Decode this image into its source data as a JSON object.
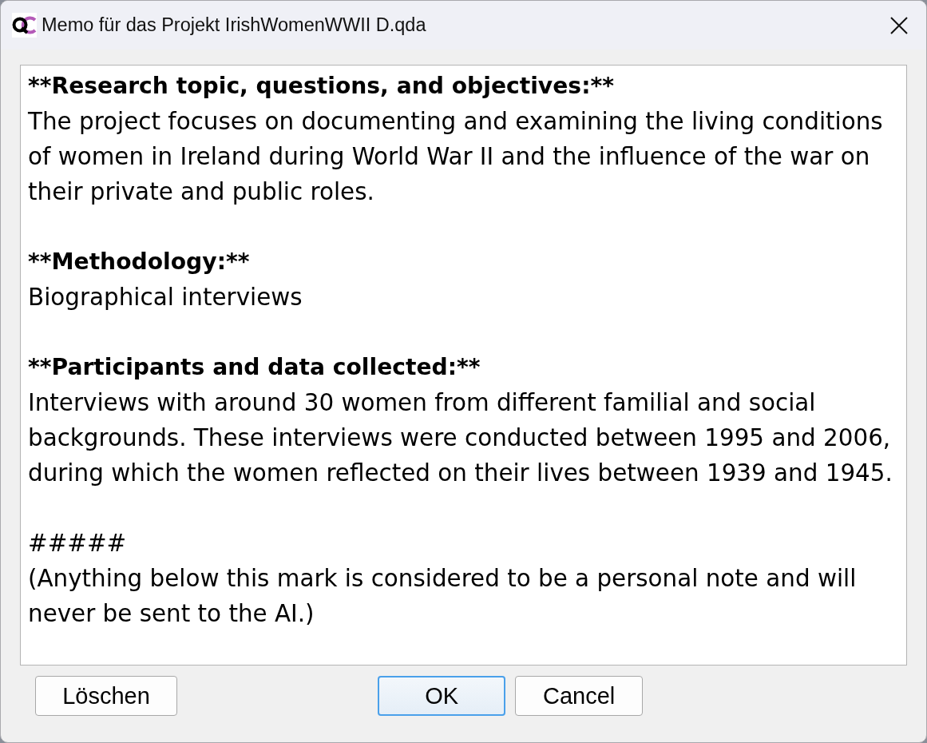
{
  "window": {
    "title": "Memo für das Projekt IrishWomenWWII D.qda"
  },
  "memo": {
    "blocks": [
      {
        "lines": [
          {
            "kind": "heading",
            "text": "**Research topic, questions, and objectives:**"
          },
          {
            "kind": "text",
            "text": "The project focuses on documenting and examining the living conditions of women in Ireland during World War II and the influence of the war on their private and public roles."
          }
        ]
      },
      {
        "lines": [
          {
            "kind": "heading",
            "text": "**Methodology:**"
          },
          {
            "kind": "text",
            "text": "Biographical interviews"
          }
        ]
      },
      {
        "lines": [
          {
            "kind": "heading",
            "text": "**Participants and data collected:**"
          },
          {
            "kind": "text",
            "text": "Interviews with around 30 women from different familial and social backgrounds. These interviews were conducted between 1995 and 2006, during which the women reflected on their lives between 1939 and 1945."
          }
        ]
      },
      {
        "lines": [
          {
            "kind": "text",
            "text": "#####"
          },
          {
            "kind": "text",
            "text": "(Anything below this mark is considered to be a personal note and will never be sent to the AI.)"
          }
        ]
      }
    ]
  },
  "buttons": {
    "left": [
      {
        "label": "Löschen",
        "default": false
      }
    ],
    "right": [
      {
        "label": "OK",
        "default": true
      },
      {
        "label": "Cancel",
        "default": false
      }
    ]
  }
}
